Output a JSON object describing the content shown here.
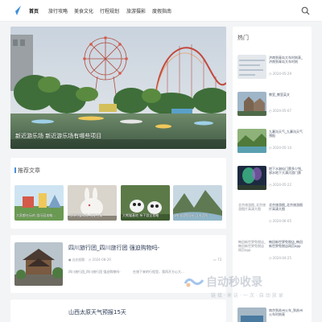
{
  "nav": {
    "items": [
      {
        "label": "首页",
        "active": true
      },
      {
        "label": "旅行攻略",
        "active": false
      },
      {
        "label": "美食文化",
        "active": false
      },
      {
        "label": "行程规划",
        "active": false
      },
      {
        "label": "旅游摄影",
        "active": false
      },
      {
        "label": "度假指南",
        "active": false
      }
    ],
    "search_icon": "search-icon",
    "logo_icon": "site-logo"
  },
  "hero": {
    "caption": "新近游乐场 新近游乐场有哪些项目",
    "slide_count": 2
  },
  "recommended": {
    "title": "推荐文章",
    "items": [
      {
        "label": "大家都在玩的 游乐园攻略..."
      },
      {
        "label": "兔年可爱动物 萌宠合集"
      },
      {
        "label": "大熊猫基地 亲子游全攻略"
      },
      {
        "label": "四川自然风光 山水之间"
      }
    ]
  },
  "posts": [
    {
      "title": "四川旅行团_四川旅行团 强迫购物吗-",
      "author": "自由随影",
      "date": "2024-08-29",
      "excerpt": "四川旅行团_四川旅行团 强迫购物吗-",
      "excerpt2": "在旅下来的行程里，我再开方心大...",
      "comments": "73"
    },
    {
      "title": "山西太原天气预报15天"
    }
  ],
  "sidebar": {
    "title": "热门",
    "items": [
      {
        "title": "济南到青岛大车时刻表_济南到青岛大车时刻",
        "date": "2024-05-29",
        "broken": false
      },
      {
        "title": "教室_教室英文",
        "date": "2024-05-07",
        "broken": false
      },
      {
        "title": "九寨沟天气_九寨沟天气预报",
        "date": "2024-05-14",
        "broken": false
      },
      {
        "title": "地下水淋仙门票多少钱_邪水地下大满河游门票",
        "date": "2024-05-22",
        "broken": false
      },
      {
        "title": "北京旅游图_北京旅游图片高清大图",
        "date": "2024-06-05",
        "broken": true,
        "alt": "北京旅游图_北京旅游图片高清大图"
      },
      {
        "title": "韩田新世界免税店_韩田新世界免税店网页app",
        "date": "2024-04-25",
        "broken": true,
        "alt": "韩田新世界免税店_韩田新世界免税店网页app"
      },
      {
        "title": "南京到苏州火车_到苏州火车时刻表",
        "date": "",
        "broken": false
      }
    ]
  },
  "watermark": {
    "text": "自动秒收录",
    "sub": "链接·来访·一次·自动放录"
  },
  "colors": {
    "accent": "#4a90d9",
    "title": "#2b3a55",
    "meta": "#a0a4ab",
    "background": "#f3f4f6"
  }
}
